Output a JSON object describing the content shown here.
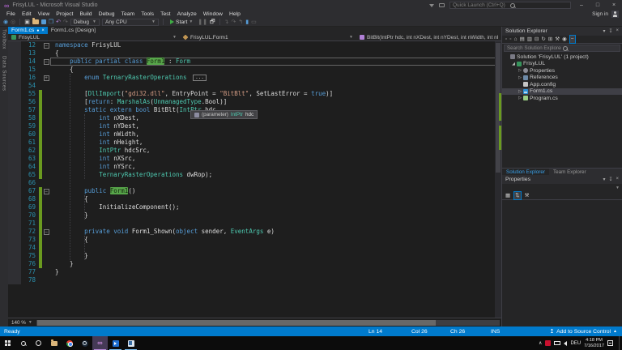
{
  "colors": {
    "accent": "#007ACC",
    "keyword": "#569CD6",
    "type": "#4EC9B0",
    "string": "#D69D85",
    "reference_highlight": "#57A64A",
    "change_bar": "#6A9A1F"
  },
  "window": {
    "title": "FrisyLUL - Microsoft Visual Studio",
    "quick_launch_placeholder": "Quick Launch (Ctrl+Q)",
    "sign_in": "Sign in"
  },
  "menus": [
    "File",
    "Edit",
    "View",
    "Project",
    "Build",
    "Debug",
    "Team",
    "Tools",
    "Test",
    "Analyze",
    "Window",
    "Help"
  ],
  "toolbar": {
    "config": "Debug",
    "platform": "Any CPU",
    "start": "Start"
  },
  "left_dock": [
    "Toolbox",
    "Data Sources"
  ],
  "editor": {
    "tabs": [
      {
        "label": "Form1.cs",
        "active": true,
        "dirty": true
      },
      {
        "label": "Form1.cs [Design]",
        "active": false,
        "dirty": false
      }
    ],
    "navbar": {
      "project": "FrisyLUL",
      "type": "FrisyLUL.Form1",
      "member": "BitBlt(IntPtr hdc, int nXDest, int nYDest, int nWidth, int nHeight, IntPtr hdcSrc, int nXSrc, int nYSrc, TernaryRasterOperations dwRop)"
    },
    "zoom": "140 %",
    "tooltip": {
      "kind": "(parameter)",
      "type": "IntPtr",
      "id": "hdc"
    },
    "lines": [
      {
        "n": 12,
        "f": "-",
        "c": [
          [
            "k",
            "namespace"
          ],
          [
            "p",
            " FrisyLUL"
          ]
        ]
      },
      {
        "n": 13,
        "c": [
          [
            "p",
            "{"
          ]
        ]
      },
      {
        "n": 14,
        "f": "-",
        "box": true,
        "c": [
          [
            "p",
            "    "
          ],
          [
            "k",
            "public partial class "
          ],
          [
            "h",
            "Form1"
          ],
          [
            "p",
            " : "
          ],
          [
            "t",
            "Form"
          ]
        ]
      },
      {
        "n": 15,
        "c": [
          [
            "p",
            "    {"
          ]
        ]
      },
      {
        "n": 16,
        "f": "+",
        "x": "...",
        "c": [
          [
            "p",
            "        "
          ],
          [
            "k",
            "enum"
          ],
          [
            "p",
            " "
          ],
          [
            "t",
            "TernaryRasterOperations"
          ],
          [
            "p",
            " "
          ]
        ]
      },
      {
        "n": 54,
        "c": []
      },
      {
        "n": 55,
        "g": 1,
        "c": [
          [
            "p",
            "        ["
          ],
          [
            "t",
            "DllImport"
          ],
          [
            "p",
            "("
          ],
          [
            "s",
            "\"gdi32.dll\""
          ],
          [
            "p",
            ", EntryPoint = "
          ],
          [
            "s",
            "\"BitBlt\""
          ],
          [
            "p",
            ", SetLastError = "
          ],
          [
            "k",
            "true"
          ],
          [
            "p",
            ")]"
          ]
        ]
      },
      {
        "n": 56,
        "g": 1,
        "c": [
          [
            "p",
            "        ["
          ],
          [
            "k",
            "return"
          ],
          [
            "p",
            ": "
          ],
          [
            "t",
            "MarshalAs"
          ],
          [
            "p",
            "("
          ],
          [
            "t",
            "UnmanagedType"
          ],
          [
            "p",
            ".Bool)]"
          ]
        ]
      },
      {
        "n": 57,
        "g": 1,
        "c": [
          [
            "p",
            "        "
          ],
          [
            "k",
            "static extern bool"
          ],
          [
            "p",
            " BitBlt("
          ],
          [
            "t",
            "IntPtr"
          ],
          [
            "p",
            " hdc,"
          ]
        ]
      },
      {
        "n": 58,
        "g": 1,
        "c": [
          [
            "p",
            "            "
          ],
          [
            "k",
            "int"
          ],
          [
            "p",
            " nXDest,"
          ]
        ]
      },
      {
        "n": 59,
        "g": 1,
        "c": [
          [
            "p",
            "            "
          ],
          [
            "k",
            "int"
          ],
          [
            "p",
            " nYDest,"
          ]
        ]
      },
      {
        "n": 60,
        "g": 1,
        "c": [
          [
            "p",
            "            "
          ],
          [
            "k",
            "int"
          ],
          [
            "p",
            " nWidth,"
          ]
        ]
      },
      {
        "n": 61,
        "g": 1,
        "c": [
          [
            "p",
            "            "
          ],
          [
            "k",
            "int"
          ],
          [
            "p",
            " nHeight,"
          ]
        ]
      },
      {
        "n": 62,
        "g": 1,
        "c": [
          [
            "p",
            "            "
          ],
          [
            "t",
            "IntPtr"
          ],
          [
            "p",
            " hdcSrc,"
          ]
        ]
      },
      {
        "n": 63,
        "g": 1,
        "c": [
          [
            "p",
            "            "
          ],
          [
            "k",
            "int"
          ],
          [
            "p",
            " nXSrc,"
          ]
        ]
      },
      {
        "n": 64,
        "g": 1,
        "c": [
          [
            "p",
            "            "
          ],
          [
            "k",
            "int"
          ],
          [
            "p",
            " nYSrc,"
          ]
        ]
      },
      {
        "n": 65,
        "g": 1,
        "c": [
          [
            "p",
            "            "
          ],
          [
            "t",
            "TernaryRasterOperations"
          ],
          [
            "p",
            " dwRop);"
          ]
        ]
      },
      {
        "n": 66,
        "c": []
      },
      {
        "n": 67,
        "g": 1,
        "f": "-",
        "c": [
          [
            "p",
            "        "
          ],
          [
            "k",
            "public"
          ],
          [
            "p",
            " "
          ],
          [
            "h",
            "Form1"
          ],
          [
            "p",
            "()"
          ]
        ]
      },
      {
        "n": 68,
        "g": 1,
        "c": [
          [
            "p",
            "        {"
          ]
        ]
      },
      {
        "n": 69,
        "g": 1,
        "c": [
          [
            "p",
            "            InitializeComponent();"
          ]
        ]
      },
      {
        "n": 70,
        "g": 1,
        "c": [
          [
            "p",
            "        }"
          ]
        ]
      },
      {
        "n": 71,
        "g": 1,
        "c": []
      },
      {
        "n": 72,
        "g": 1,
        "f": "-",
        "c": [
          [
            "p",
            "        "
          ],
          [
            "k",
            "private void"
          ],
          [
            "p",
            " Form1_Shown("
          ],
          [
            "k",
            "object"
          ],
          [
            "p",
            " sender, "
          ],
          [
            "t",
            "EventArgs"
          ],
          [
            "p",
            " e)"
          ]
        ]
      },
      {
        "n": 73,
        "g": 1,
        "c": [
          [
            "p",
            "        {"
          ]
        ]
      },
      {
        "n": 74,
        "g": 1,
        "c": []
      },
      {
        "n": 75,
        "g": 1,
        "c": [
          [
            "p",
            "        }"
          ]
        ]
      },
      {
        "n": 76,
        "g": 1,
        "c": [
          [
            "p",
            "    }"
          ]
        ]
      },
      {
        "n": 77,
        "c": [
          [
            "p",
            "}"
          ]
        ]
      },
      {
        "n": 78,
        "c": []
      }
    ]
  },
  "solution_explorer": {
    "title": "Solution Explorer",
    "search_placeholder": "Search Solution Explorer (Ctrl+;)",
    "tree": [
      {
        "label": "Solution 'FrisyLUL' (1 project)",
        "icon": "solution",
        "indent": 0
      },
      {
        "label": "FrisyLUL",
        "icon": "csproj",
        "indent": 1,
        "arrow": "open"
      },
      {
        "label": "Properties",
        "icon": "properties",
        "indent": 2,
        "arrow": "closed"
      },
      {
        "label": "References",
        "icon": "references",
        "indent": 2,
        "arrow": "closed"
      },
      {
        "label": "App.config",
        "icon": "config",
        "indent": 2
      },
      {
        "label": "Form1.cs",
        "icon": "form",
        "indent": 2,
        "arrow": "closed",
        "selected": true
      },
      {
        "label": "Program.cs",
        "icon": "csfile",
        "indent": 2,
        "arrow": "closed"
      }
    ]
  },
  "panel_tabs": {
    "solution": "Solution Explorer",
    "team": "Team Explorer"
  },
  "properties": {
    "title": "Properties"
  },
  "status_bar": {
    "ready": "Ready",
    "ln": "Ln 14",
    "col": "Col 26",
    "ch": "Ch 26",
    "ins": "INS",
    "source_control": "Add to Source Control"
  },
  "taskbar": {
    "lang": "DEU",
    "time": "4:18 PM",
    "date": "7/16/2017"
  }
}
